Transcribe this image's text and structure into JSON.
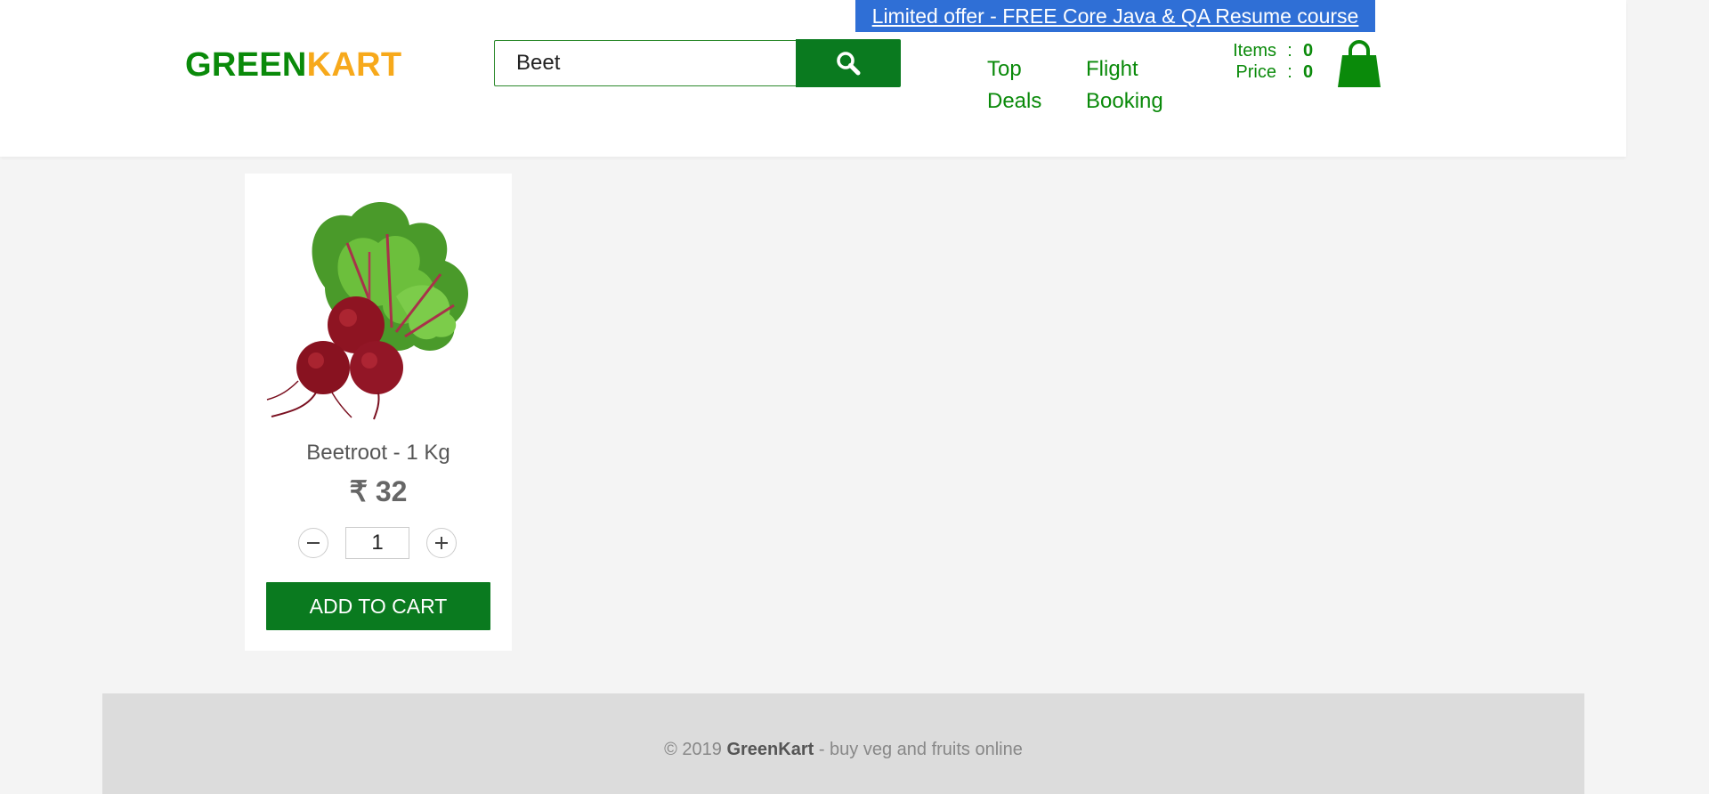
{
  "promo": {
    "text": "Limited offer - FREE Core Java & QA Resume course"
  },
  "brand": {
    "part1": "GREEN",
    "part2": "KART"
  },
  "search": {
    "value": "Beet",
    "button_icon": "search-icon"
  },
  "nav": {
    "top_deals": [
      "Top",
      "Deals"
    ],
    "flight_booking": [
      "Flight",
      "Booking"
    ]
  },
  "cart": {
    "items_label": "Items",
    "items_value": "0",
    "price_label": "Price",
    "price_value": "0",
    "separator": ":",
    "icon": "shopping-bag-icon"
  },
  "products": [
    {
      "name": "Beetroot - 1 Kg",
      "price": "₹ 32",
      "quantity": "1",
      "button_label": "ADD TO CART",
      "image": "beetroot-image"
    }
  ],
  "footer": {
    "prefix": "© 2019 ",
    "brand": "GreenKart",
    "suffix": " - buy veg and fruits online"
  },
  "colors": {
    "brand_green": "#0a8a0a",
    "brand_orange": "#f7a91b",
    "button_green": "#0a7a1f",
    "promo_blue": "#2f6fd6"
  }
}
